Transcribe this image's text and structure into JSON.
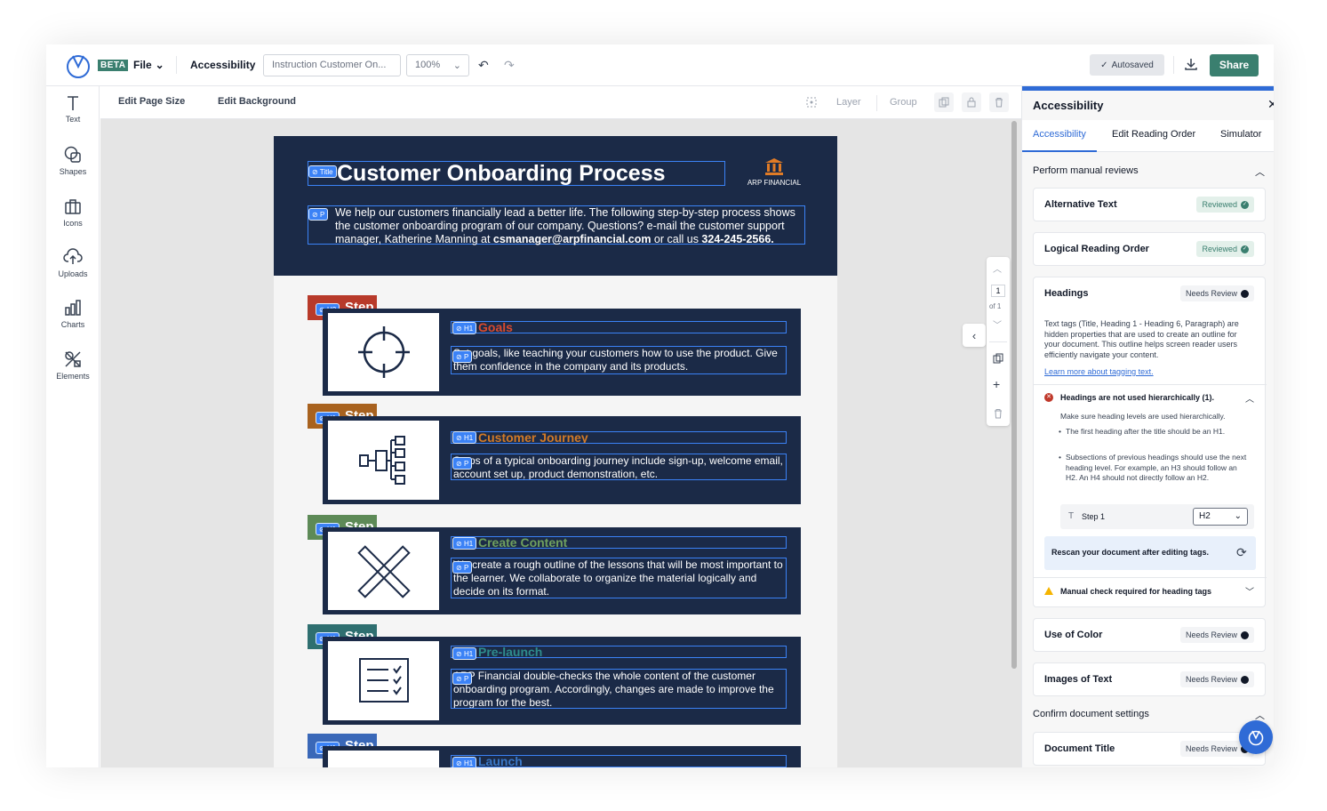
{
  "topbar": {
    "beta_label": "BETA",
    "file_label": "File",
    "accessibility_label": "Accessibility",
    "document_name": "Instruction Customer On...",
    "zoom": "100%",
    "autosaved_label": "Autosaved",
    "share_label": "Share"
  },
  "leftbar": {
    "items": [
      {
        "label": "Text",
        "icon": "text-icon"
      },
      {
        "label": "Shapes",
        "icon": "shapes-icon"
      },
      {
        "label": "Icons",
        "icon": "icons-icon"
      },
      {
        "label": "Uploads",
        "icon": "upload-icon"
      },
      {
        "label": "Charts",
        "icon": "chart-icon"
      },
      {
        "label": "Elements",
        "icon": "elements-icon"
      }
    ]
  },
  "toolbar": {
    "edit_page_size": "Edit Page Size",
    "edit_background": "Edit Background",
    "layer": "Layer",
    "group": "Group"
  },
  "document": {
    "title": "Customer Onboarding Process",
    "intro_1": "We help our customers financially lead a better life. The following step-by-step process shows the customer onboarding program of our company. Questions? e-mail the customer support manager, Katherine Manning at ",
    "intro_email": "csmanager@arpfinancial.com",
    "intro_2": " or call us ",
    "intro_phone": "324-245-2566.",
    "brand": "ARP FINANCIAL",
    "steps": [
      {
        "label": "Step 1",
        "label_tag": "H2",
        "heading": "Goals",
        "heading_tag": "H1",
        "text": "Set goals, like teaching your customers how to use the product. Give them confidence in the company and its products.",
        "color": "#b83a2a",
        "heading_color": "#d94a2e",
        "icon": "crosshair-icon"
      },
      {
        "label": "Step 2",
        "label_tag": "H1",
        "heading": "Customer Journey",
        "heading_tag": "H1",
        "text": "Steps of a typical onboarding journey include sign-up, welcome email, account set up, product demonstration, etc.",
        "color": "#a8621f",
        "heading_color": "#d27a27",
        "icon": "flowchart-icon"
      },
      {
        "label": "Step 3",
        "label_tag": "H1",
        "heading": "Create Content",
        "heading_tag": "H1",
        "text": "We create a rough outline of the lessons that will be most important to the learner. We collaborate to organize the material logically and decide on its format.",
        "color": "#5d8a57",
        "heading_color": "#6fa05f",
        "icon": "ruler-pencil-icon"
      },
      {
        "label": "Step 4",
        "label_tag": "H1",
        "heading": "Pre-launch",
        "heading_tag": "H1",
        "text": "ARP Financial double-checks the whole content of the customer onboarding program. Accordingly, changes are made to improve the program for the best.",
        "color": "#2f6f70",
        "heading_color": "#2e8c8c",
        "icon": "checklist-icon"
      },
      {
        "label": "Step 5",
        "label_tag": "H1",
        "heading": "Launch",
        "heading_tag": "H1",
        "text": "",
        "color": "#3a68b8",
        "heading_color": "#3a78c8",
        "icon": "launch-icon"
      }
    ],
    "title_tag": "Title",
    "intro_tag": "P",
    "text_tag": "P"
  },
  "page_controls": {
    "page_number": "1",
    "page_total": "of 1"
  },
  "panel": {
    "title": "Accessibility",
    "tabs": [
      "Accessibility",
      "Edit Reading Order",
      "Simulator"
    ],
    "manual_section": "Perform manual reviews",
    "alt_text": {
      "title": "Alternative Text",
      "status": "Reviewed"
    },
    "reading_order": {
      "title": "Logical Reading Order",
      "status": "Reviewed"
    },
    "headings": {
      "title": "Headings",
      "status": "Needs Review",
      "description": "Text tags (Title, Heading 1 - Heading 6, Paragraph) are hidden properties that are used to create an outline for your document. This outline helps screen reader users efficiently navigate your content.",
      "learn_more": "Learn more about tagging text.",
      "error_title": "Headings are not used hierarchically (1).",
      "error_body": "Make sure heading levels are used hierarchically.",
      "bullet_1": "The first heading after the title should be an H1.",
      "bullet_2": "Subsections of previous headings should use the next heading level. For example, an H3 should follow an H2. An H4 should not directly follow an H2.",
      "step_label": "Step 1",
      "step_level": "H2",
      "rescan": "Rescan your document after editing tags.",
      "warning": "Manual check required for heading tags"
    },
    "use_of_color": {
      "title": "Use of Color",
      "status": "Needs Review"
    },
    "images_of_text": {
      "title": "Images of Text",
      "status": "Needs Review"
    },
    "confirm_section": "Confirm document settings",
    "document_title": {
      "title": "Document Title",
      "status": "Needs Review"
    }
  },
  "colors": {
    "brand": "#3a7f6f",
    "navy": "#1b2a47",
    "accent_blue": "#2f6bd6",
    "tag_blue": "#3b82f6"
  }
}
